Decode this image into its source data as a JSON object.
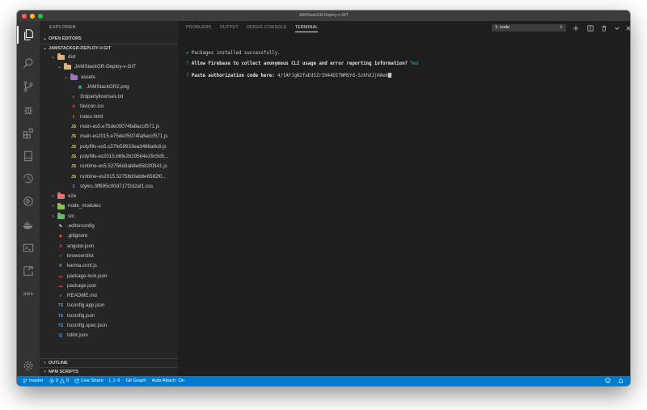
{
  "window": {
    "title": "JAMStackGR-Deploy-v-GIT"
  },
  "activity_bar": {
    "items": [
      {
        "name": "explorer-icon"
      },
      {
        "name": "search-icon"
      },
      {
        "name": "source-control-icon"
      },
      {
        "name": "debug-icon"
      },
      {
        "name": "extensions-icon"
      },
      {
        "name": "test-icon"
      },
      {
        "name": "timeline-icon"
      },
      {
        "name": "live-share-icon"
      },
      {
        "name": "docker-icon"
      },
      {
        "name": "remote-explorer-icon"
      },
      {
        "name": "azure-icon"
      }
    ],
    "aws_label": "aws"
  },
  "sidebar": {
    "header": "EXPLORER",
    "open_editors": "OPEN EDITORS",
    "project": "JAMSTACKGR-DEPLOY-V-GIT",
    "tree": [
      {
        "label": "dist",
        "depth": 1,
        "kind": "folder",
        "open": true,
        "color": "#dcb67a"
      },
      {
        "label": "JAMStackGR-Deploy-v-GIT",
        "depth": 2,
        "kind": "folder",
        "open": true,
        "color": "#dcb67a"
      },
      {
        "label": "assets",
        "depth": 3,
        "kind": "folder",
        "open": true,
        "color": "#a074c4"
      },
      {
        "label": "JAMStackGR2.png",
        "depth": 4,
        "kind": "file",
        "icon": "image",
        "color": "#26a69a"
      },
      {
        "label": "3rdpartylicenses.txt",
        "depth": 3,
        "kind": "file",
        "icon": "txt",
        "color": "#8a8a8a"
      },
      {
        "label": "favicon.ico",
        "depth": 3,
        "kind": "file",
        "icon": "ico",
        "color": "#e44d26"
      },
      {
        "label": "index.html",
        "depth": 3,
        "kind": "file",
        "icon": "html",
        "color": "#e44d26"
      },
      {
        "label": "main-es5.e75de05074fa8accf571.js",
        "depth": 3,
        "kind": "file",
        "icon": "js",
        "color": "#e8d44d"
      },
      {
        "label": "main-es2015.e75de05074fa8accf571.js",
        "depth": 3,
        "kind": "file",
        "icon": "js",
        "color": "#e8d44d"
      },
      {
        "label": "polyfills-es5.c37fe59933ea3486a8c8.js",
        "depth": 3,
        "kind": "file",
        "icon": "js",
        "color": "#e8d44d"
      },
      {
        "label": "polyfills-es2015.b6fe2b19564e29c5d5...",
        "depth": 3,
        "kind": "file",
        "icon": "js",
        "color": "#e8d44d"
      },
      {
        "label": "runtime-es5.52756d3ab8e6582f0541.js",
        "depth": 3,
        "kind": "file",
        "icon": "js",
        "color": "#e8d44d"
      },
      {
        "label": "runtime-es2015.52756d3ab8e6582f0...",
        "depth": 3,
        "kind": "file",
        "icon": "js",
        "color": "#e8d44d"
      },
      {
        "label": "styles.3ff695c00d717f2d2af1.css",
        "depth": 3,
        "kind": "file",
        "icon": "css",
        "color": "#42a5f5"
      },
      {
        "label": "e2e",
        "depth": 1,
        "kind": "folder",
        "open": false,
        "color": "#e57373"
      },
      {
        "label": "node_modules",
        "depth": 1,
        "kind": "folder",
        "open": false,
        "color": "#8bc34a"
      },
      {
        "label": "src",
        "depth": 1,
        "kind": "folder",
        "open": false,
        "color": "#66bb6a"
      },
      {
        "label": ".editorconfig",
        "depth": 1,
        "kind": "file",
        "icon": "editorconfig",
        "color": "#e0e0e0"
      },
      {
        "label": ".gitignore",
        "depth": 1,
        "kind": "file",
        "icon": "git",
        "color": "#f4511e"
      },
      {
        "label": "angular.json",
        "depth": 1,
        "kind": "file",
        "icon": "angular",
        "color": "#e53935"
      },
      {
        "label": "browserslist",
        "depth": 1,
        "kind": "file",
        "icon": "browserslist",
        "color": "#ffca28"
      },
      {
        "label": "karma.conf.js",
        "depth": 1,
        "kind": "file",
        "icon": "karma",
        "color": "#3bb9a6"
      },
      {
        "label": "package-lock.json",
        "depth": 1,
        "kind": "file",
        "icon": "npm",
        "color": "#cb3837"
      },
      {
        "label": "package.json",
        "depth": 1,
        "kind": "file",
        "icon": "npm",
        "color": "#cb3837"
      },
      {
        "label": "README.md",
        "depth": 1,
        "kind": "file",
        "icon": "md",
        "color": "#42a5f5"
      },
      {
        "label": "tsconfig.app.json",
        "depth": 1,
        "kind": "file",
        "icon": "ts",
        "color": "#42a5f5"
      },
      {
        "label": "tsconfig.json",
        "depth": 1,
        "kind": "file",
        "icon": "ts",
        "color": "#42a5f5"
      },
      {
        "label": "tsconfig.spec.json",
        "depth": 1,
        "kind": "file",
        "icon": "ts",
        "color": "#42a5f5"
      },
      {
        "label": "tslint.json",
        "depth": 1,
        "kind": "file",
        "icon": "json",
        "color": "#42a5f5"
      }
    ],
    "outline": "OUTLINE",
    "npm_scripts": "NPM SCRIPTS"
  },
  "panel": {
    "tabs": [
      "PROBLEMS",
      "OUTPUT",
      "DEBUG CONSOLE",
      "TERMINAL"
    ],
    "active_tab": "TERMINAL",
    "terminal_select": "1: node",
    "terminal_lines": [
      {
        "prefix": "✔",
        "text": " Packages installed successfully."
      },
      {
        "prefix": "?",
        "text": " Allow Firebase to collect anonymous CLI usage and error reporting information?",
        "answer": " Yes"
      },
      {
        "prefix": "?",
        "text": " Paste authorization code here:",
        "answer": " 4/tAFJgN2faEd5ZrIH44DIfWMSYd-SzkhXJjHAe6"
      }
    ]
  },
  "statusbar": {
    "branch": "master",
    "errors": "0",
    "warnings": "0",
    "live_share": "Live Share",
    "brackets": "{..}: 6",
    "git_graph": "Git Graph",
    "auto_attach": "Auto Attach: On"
  },
  "colors": {
    "accent": "#007acc",
    "sidebar_bg": "#252526",
    "editor_bg": "#1e1e1e"
  }
}
